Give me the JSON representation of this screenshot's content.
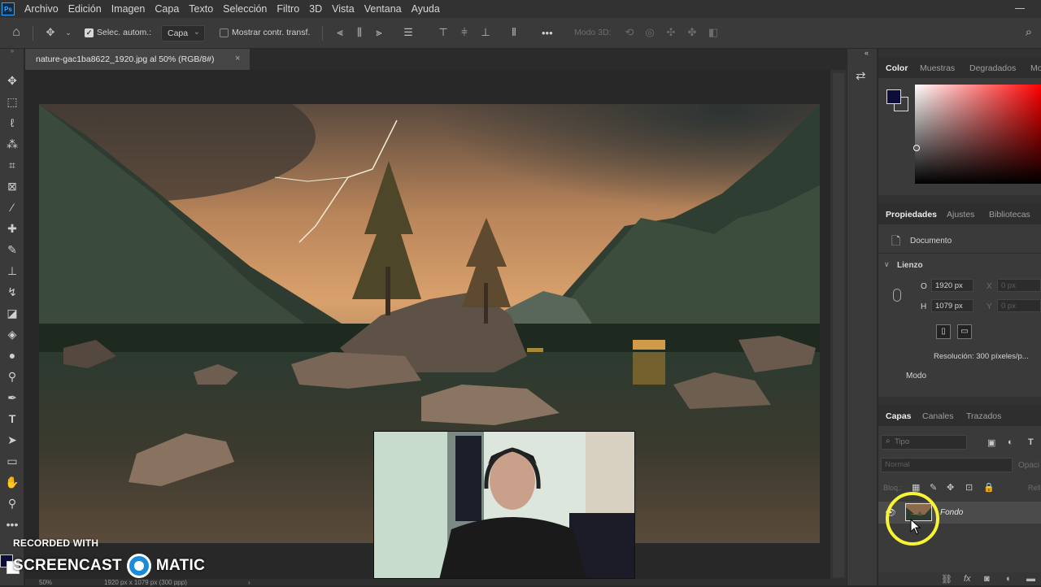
{
  "menubar": {
    "app_logo": "Ps",
    "items": [
      "Archivo",
      "Edición",
      "Imagen",
      "Capa",
      "Texto",
      "Selección",
      "Filtro",
      "3D",
      "Vista",
      "Ventana",
      "Ayuda"
    ]
  },
  "options_bar": {
    "auto_select_label": "Selec. autom.:",
    "auto_select_checked": true,
    "auto_select_target": "Capa",
    "show_transform_label": "Mostrar contr. transf.",
    "show_transform_checked": false,
    "more_label": "•••",
    "mode_3d_label": "Modo 3D:"
  },
  "document": {
    "tab_title": "nature-gac1ba8622_1920.jpg al 50% (RGB/8#)",
    "close_glyph": "×",
    "zoom": "50%",
    "dimensions": "1920 px x 1079 px (300 ppp)",
    "status_arrow": "›"
  },
  "color_panel": {
    "tabs": [
      "Color",
      "Muestras",
      "Degradados",
      "Mo"
    ],
    "active_tab": "Color",
    "foreground_color": "#0d0d3a"
  },
  "properties_panel": {
    "tabs": [
      "Propiedades",
      "Ajustes",
      "Bibliotecas"
    ],
    "active_tab": "Propiedades",
    "document_label": "Documento",
    "section_title": "Lienzo",
    "width_label": "O",
    "width_value": "1920 px",
    "height_label": "H",
    "height_value": "1079 px",
    "x_label": "X",
    "x_value": "0 px",
    "y_label": "Y",
    "y_value": "0 px",
    "resolution": "Resolución: 300 píxeles/p...",
    "mode_label": "Modo"
  },
  "layers_panel": {
    "tabs": [
      "Capas",
      "Canales",
      "Trazados"
    ],
    "active_tab": "Capas",
    "search_placeholder": "Tipo",
    "blend_mode": "Normal",
    "opacity_label": "Opaci",
    "lock_label": "Bloq.:",
    "fill_label": "Rell",
    "layers": [
      {
        "name": "Fondo",
        "visible": true
      }
    ]
  },
  "watermark": {
    "line1": "RECORDED WITH",
    "brand_left": "SCREENCAST",
    "brand_right": "MATIC"
  }
}
